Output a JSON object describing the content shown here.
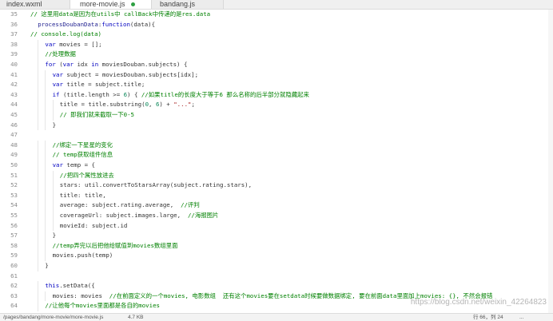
{
  "tabs": [
    {
      "label": "index.wxml"
    },
    {
      "label": "more-movie.js"
    },
    {
      "label": "bandang.js"
    }
  ],
  "lines": [
    {
      "num": "35",
      "indent": 0,
      "tokens": [
        {
          "t": "// 这里用data是因为在utils中 callBack中传递的是res.data",
          "c": "c"
        }
      ]
    },
    {
      "num": "36",
      "indent": 1,
      "tokens": [
        {
          "t": "processDoubanData",
          "c": "p"
        },
        {
          "t": ":",
          "c": ""
        },
        {
          "t": "function",
          "c": "k"
        },
        {
          "t": "(data){",
          "c": ""
        }
      ]
    },
    {
      "num": "37",
      "indent": 0,
      "tokens": [
        {
          "t": "// console.log(data)",
          "c": "c"
        }
      ]
    },
    {
      "num": "38",
      "indent": 2,
      "tokens": [
        {
          "t": "var",
          "c": "k"
        },
        {
          "t": " movies = [];",
          "c": ""
        }
      ]
    },
    {
      "num": "39",
      "indent": 2,
      "tokens": [
        {
          "t": "//处理数据",
          "c": "c"
        }
      ]
    },
    {
      "num": "40",
      "indent": 2,
      "tokens": [
        {
          "t": "for",
          "c": "k"
        },
        {
          "t": " (",
          "c": ""
        },
        {
          "t": "var",
          "c": "k"
        },
        {
          "t": " idx ",
          "c": ""
        },
        {
          "t": "in",
          "c": "k"
        },
        {
          "t": " moviesDouban.subjects) {",
          "c": ""
        }
      ]
    },
    {
      "num": "41",
      "indent": 3,
      "tokens": [
        {
          "t": "var",
          "c": "k"
        },
        {
          "t": " subject = moviesDouban.subjects[idx];",
          "c": ""
        }
      ]
    },
    {
      "num": "42",
      "indent": 3,
      "tokens": [
        {
          "t": "var",
          "c": "k"
        },
        {
          "t": " title = subject.title;",
          "c": ""
        }
      ]
    },
    {
      "num": "43",
      "indent": 3,
      "tokens": [
        {
          "t": "if",
          "c": "k"
        },
        {
          "t": " (title.length >= ",
          "c": ""
        },
        {
          "t": "6",
          "c": "n"
        },
        {
          "t": ") { ",
          "c": ""
        },
        {
          "t": "//如果title的长度大于等于6 那么名称的后半部分就隐藏起来",
          "c": "c"
        }
      ]
    },
    {
      "num": "44",
      "indent": 4,
      "tokens": [
        {
          "t": "title = title.substring(",
          "c": ""
        },
        {
          "t": "0",
          "c": "n"
        },
        {
          "t": ", ",
          "c": ""
        },
        {
          "t": "6",
          "c": "n"
        },
        {
          "t": ") + ",
          "c": ""
        },
        {
          "t": "\"...\"",
          "c": "s"
        },
        {
          "t": ";",
          "c": ""
        }
      ]
    },
    {
      "num": "45",
      "indent": 4,
      "tokens": [
        {
          "t": "// 即我们就来截取一下0-5",
          "c": "c"
        }
      ]
    },
    {
      "num": "46",
      "indent": 3,
      "tokens": [
        {
          "t": "}",
          "c": ""
        }
      ]
    },
    {
      "num": "47",
      "indent": 0,
      "tokens": []
    },
    {
      "num": "48",
      "indent": 3,
      "tokens": [
        {
          "t": "//绑定一下星星的变化",
          "c": "c"
        }
      ]
    },
    {
      "num": "49",
      "indent": 3,
      "tokens": [
        {
          "t": "// temp获取组件信息",
          "c": "c"
        }
      ]
    },
    {
      "num": "50",
      "indent": 3,
      "tokens": [
        {
          "t": "var",
          "c": "k"
        },
        {
          "t": " temp = {",
          "c": ""
        }
      ]
    },
    {
      "num": "51",
      "indent": 4,
      "tokens": [
        {
          "t": "//把四个属性放进去",
          "c": "c"
        }
      ]
    },
    {
      "num": "52",
      "indent": 4,
      "tokens": [
        {
          "t": "stars: util.convertToStarsArray(subject.rating.stars),",
          "c": ""
        }
      ]
    },
    {
      "num": "53",
      "indent": 4,
      "tokens": [
        {
          "t": "title: title,",
          "c": ""
        }
      ]
    },
    {
      "num": "54",
      "indent": 4,
      "tokens": [
        {
          "t": "average: subject.rating.average,  ",
          "c": ""
        },
        {
          "t": "//评判",
          "c": "c"
        }
      ]
    },
    {
      "num": "55",
      "indent": 4,
      "tokens": [
        {
          "t": "coverageUrl: subject.images.large,  ",
          "c": ""
        },
        {
          "t": "//海报图片",
          "c": "c"
        }
      ]
    },
    {
      "num": "56",
      "indent": 4,
      "tokens": [
        {
          "t": "movieId: subject.id",
          "c": ""
        }
      ]
    },
    {
      "num": "57",
      "indent": 3,
      "tokens": [
        {
          "t": "}",
          "c": ""
        }
      ]
    },
    {
      "num": "58",
      "indent": 3,
      "tokens": [
        {
          "t": "//temp弄完以后把他给赋值到movies数组里面",
          "c": "c"
        }
      ]
    },
    {
      "num": "59",
      "indent": 3,
      "tokens": [
        {
          "t": "movies.push(temp)",
          "c": ""
        }
      ]
    },
    {
      "num": "60",
      "indent": 2,
      "tokens": [
        {
          "t": "}",
          "c": ""
        }
      ]
    },
    {
      "num": "61",
      "indent": 0,
      "tokens": []
    },
    {
      "num": "62",
      "indent": 2,
      "tokens": [
        {
          "t": "this",
          "c": "k"
        },
        {
          "t": ".setData({",
          "c": ""
        }
      ]
    },
    {
      "num": "63",
      "indent": 3,
      "tokens": [
        {
          "t": "movies: movies  ",
          "c": ""
        },
        {
          "t": "//在前面定义的一个movies, 电影数组  还有这个movies要在setdata时候要做数据绑定, 要在前面data里面加上movies: {}, 不然会报错",
          "c": "c"
        }
      ]
    },
    {
      "num": "64",
      "indent": 2,
      "tokens": [
        {
          "t": "//让他每个movies里面都是各自的movies",
          "c": "c"
        }
      ]
    }
  ],
  "status": {
    "path": "/pages/bandang/more-movie/more-movie.js",
    "size": "4.7 KB",
    "position": "行 66，列 24",
    "extra": "..."
  },
  "watermark": "https://blog.csdn.net/weixin_42264823",
  "colors": {
    "keyword": "#0000c0",
    "comment": "#008000",
    "string": "#a31515",
    "number": "#098658",
    "function_name": "#1f1f8f",
    "modified_dot": "#2ea043"
  }
}
